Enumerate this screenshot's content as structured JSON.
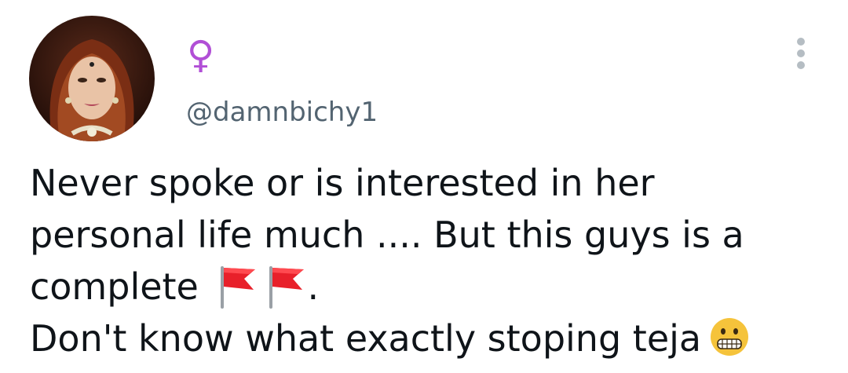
{
  "author": {
    "display_name": "♀",
    "handle": "@damnbichy1",
    "avatar": "woman-portrait"
  },
  "menu": {
    "icon": "more-vertical-icon"
  },
  "tweet": {
    "line1": "Never spoke or is interested in her",
    "line2": "personal life much .... But this guys is a",
    "line3_text": "complete ",
    "line3_emojis": [
      "red-flag-icon",
      "red-flag-icon"
    ],
    "line3_end": ".",
    "line4_text": "Don't know what exactly stoping teja",
    "line4_emoji": "grimacing-face-icon"
  },
  "colors": {
    "text": "#0f1419",
    "secondary": "#536471",
    "female_sign": "#b14fd6",
    "flag_red": "#e8202a",
    "emoji_yellow": "#f5c33b"
  }
}
